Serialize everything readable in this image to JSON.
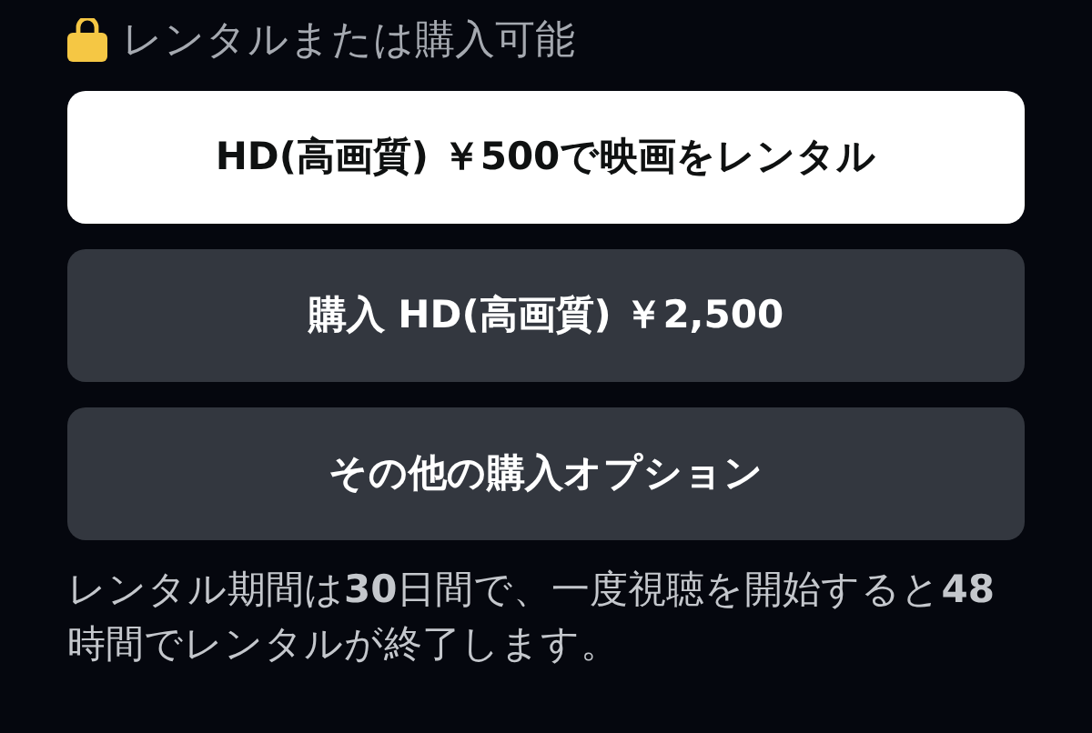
{
  "header": {
    "title": "レンタルまたは購入可能"
  },
  "buttons": [
    {
      "label": "HD(高画質) ￥500で映画をレンタル",
      "kind": "primary"
    },
    {
      "label": "購入 HD(高画質) ￥2,500",
      "kind": "secondary"
    },
    {
      "label": "その他の購入オプション",
      "kind": "secondary"
    }
  ],
  "note": "レンタル期間は**30**日間で、一度視聴を開始すると**48**時間でレンタルが終了します。"
}
